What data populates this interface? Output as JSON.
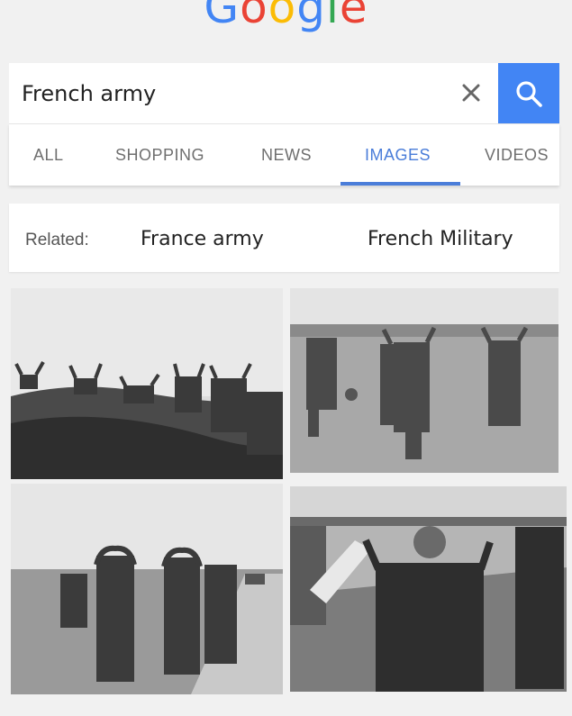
{
  "logo": {
    "text": "Google",
    "letters": [
      {
        "ch": "G",
        "color": "#4285f4"
      },
      {
        "ch": "o",
        "color": "#ea4335"
      },
      {
        "ch": "o",
        "color": "#fbbc05"
      },
      {
        "ch": "g",
        "color": "#4285f4"
      },
      {
        "ch": "l",
        "color": "#34a853"
      },
      {
        "ch": "e",
        "color": "#ea4335"
      }
    ]
  },
  "search": {
    "query": "French army",
    "clear_icon": "close-icon",
    "search_icon": "search-icon",
    "accent": "#4285f4"
  },
  "tabs": [
    {
      "label": "ALL",
      "active": false
    },
    {
      "label": "SHOPPING",
      "active": false
    },
    {
      "label": "NEWS",
      "active": false
    },
    {
      "label": "IMAGES",
      "active": true
    },
    {
      "label": "VIDEOS",
      "active": false
    }
  ],
  "related": {
    "label": "Related:",
    "chips": [
      "France army",
      "French Military"
    ]
  },
  "results": [
    {
      "name": "soldiers surrendering on hillside"
    },
    {
      "name": "soldiers walking in field with hands raised"
    },
    {
      "name": "soldiers with hands on heads by road"
    },
    {
      "name": "soldier waving white flag on dirt road"
    }
  ]
}
